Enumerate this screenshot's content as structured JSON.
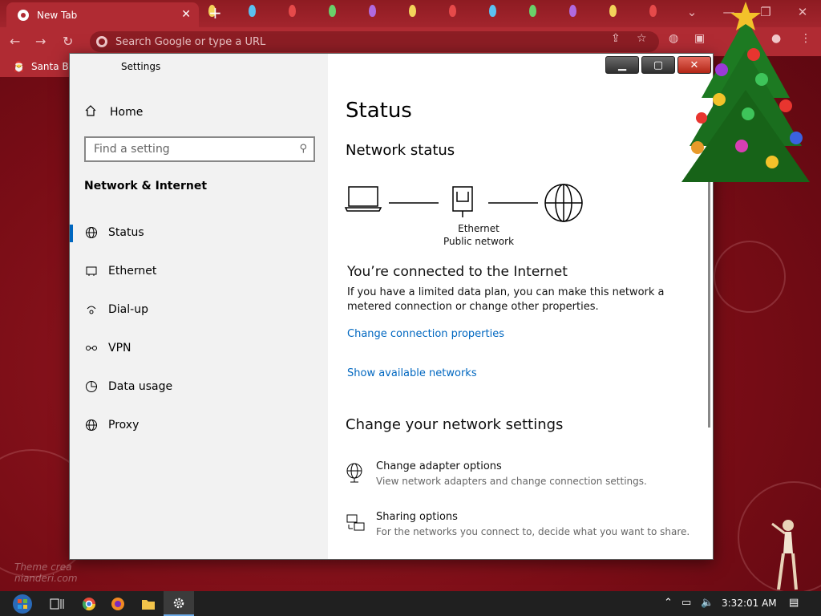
{
  "browser": {
    "tab_title": "New Tab",
    "tab_close": "✕",
    "new_tab": "+",
    "omnibox_placeholder": "Search Google or type a URL",
    "bookmark_label": "Santa Bo"
  },
  "settings": {
    "window_title": "Settings",
    "home_label": "Home",
    "search_placeholder": "Find a setting",
    "section_title": "Network & Internet",
    "nav_items": [
      {
        "label": "Status",
        "icon": "globe-icon"
      },
      {
        "label": "Ethernet",
        "icon": "ethernet-icon"
      },
      {
        "label": "Dial-up",
        "icon": "dialup-icon"
      },
      {
        "label": "VPN",
        "icon": "vpn-icon"
      },
      {
        "label": "Data usage",
        "icon": "data-usage-icon"
      },
      {
        "label": "Proxy",
        "icon": "globe-icon"
      }
    ],
    "active_item": "Status",
    "page_title": "Status",
    "network_status_heading": "Network status",
    "adapter_label": "Ethernet",
    "network_label": "Public network",
    "connected_heading": "You’re connected to the Internet",
    "connected_text": "If you have a limited data plan, you can make this network a metered connection or change other properties.",
    "link_change_props": "Change connection properties",
    "link_show_networks": "Show available networks",
    "change_settings_heading": "Change your network settings",
    "options": [
      {
        "title": "Change adapter options",
        "desc": "View network adapters and change connection settings.",
        "icon": "adapter-icon"
      },
      {
        "title": "Sharing options",
        "desc": "For the networks you connect to, decide what you want to share.",
        "icon": "sharing-icon"
      }
    ]
  },
  "taskbar": {
    "clock": "3:32:01 AM"
  },
  "wallpaper": {
    "watermark_line1": "Theme crea",
    "watermark_line2": "nianderi.com"
  },
  "colors": {
    "accent": "#0067c0",
    "chrome_frame": "#b02b33",
    "wallpaper": "#7a0d16"
  }
}
